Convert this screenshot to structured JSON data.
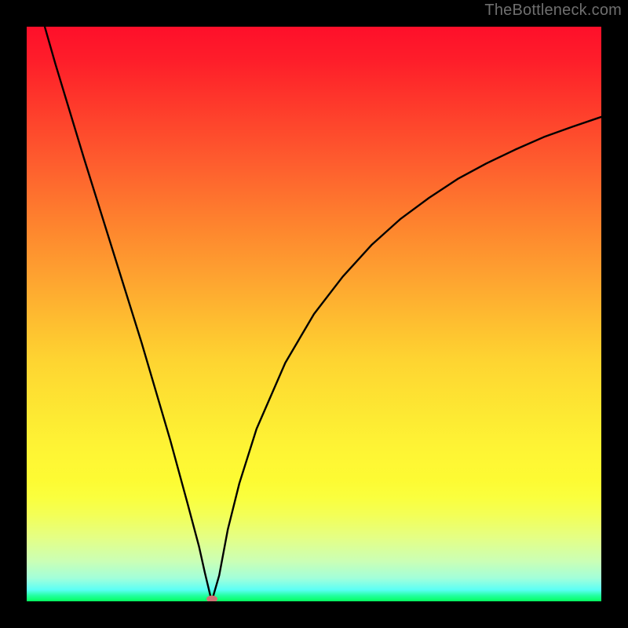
{
  "watermark": "TheBottleneck.com",
  "marker": {
    "x_frac": 0.322,
    "y_frac": 0.996
  },
  "chart_data": {
    "type": "line",
    "title": "",
    "xlabel": "",
    "ylabel": "",
    "xlim": [
      0,
      1
    ],
    "ylim": [
      0,
      1
    ],
    "series": [
      {
        "name": "curve",
        "x": [
          0.0,
          0.05,
          0.1,
          0.15,
          0.2,
          0.25,
          0.28,
          0.3,
          0.31,
          0.322,
          0.335,
          0.35,
          0.37,
          0.4,
          0.45,
          0.5,
          0.55,
          0.6,
          0.65,
          0.7,
          0.75,
          0.8,
          0.85,
          0.9,
          0.95,
          1.0
        ],
        "y": [
          1.11,
          0.935,
          0.77,
          0.61,
          0.45,
          0.28,
          0.17,
          0.095,
          0.05,
          0.0,
          0.045,
          0.125,
          0.205,
          0.3,
          0.415,
          0.5,
          0.565,
          0.62,
          0.665,
          0.702,
          0.735,
          0.762,
          0.786,
          0.808,
          0.826,
          0.843
        ]
      }
    ],
    "gradient_stops": [
      {
        "pos": 0.0,
        "color": "#fe0f2a"
      },
      {
        "pos": 0.5,
        "color": "#feb530"
      },
      {
        "pos": 0.8,
        "color": "#fdfd34"
      },
      {
        "pos": 0.92,
        "color": "#d4ffad"
      },
      {
        "pos": 1.0,
        "color": "#04ff5e"
      }
    ]
  }
}
